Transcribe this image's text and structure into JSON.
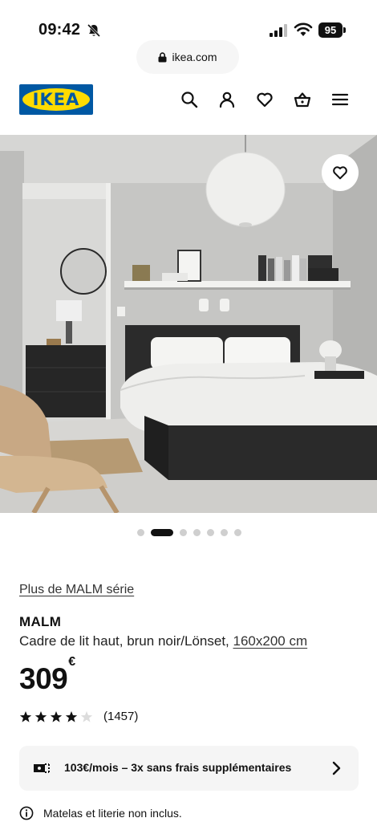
{
  "status_bar": {
    "time": "09:42",
    "battery": "95"
  },
  "browser": {
    "url": "ikea.com"
  },
  "header": {
    "logo_text": "IKEA",
    "icons": [
      "search-icon",
      "account-icon",
      "favourites-icon",
      "cart-icon",
      "menu-icon"
    ]
  },
  "gallery": {
    "image_count": 7,
    "active_index": 1
  },
  "product": {
    "series_link": "Plus de MALM série",
    "name": "MALM",
    "description": "Cadre de lit haut, brun noir/Lönset,",
    "size": "160x200 cm",
    "price": "309",
    "currency": "€",
    "rating": 4,
    "rating_max": 5,
    "review_count": "(1457)",
    "payment_text": "103€/mois – 3x sans frais supplémentaires",
    "note": "Matelas et literie non inclus."
  },
  "colors": {
    "ikea_blue": "#0058a3",
    "ikea_yellow": "#ffdb00",
    "bed_frame": "#2b2b2b"
  }
}
